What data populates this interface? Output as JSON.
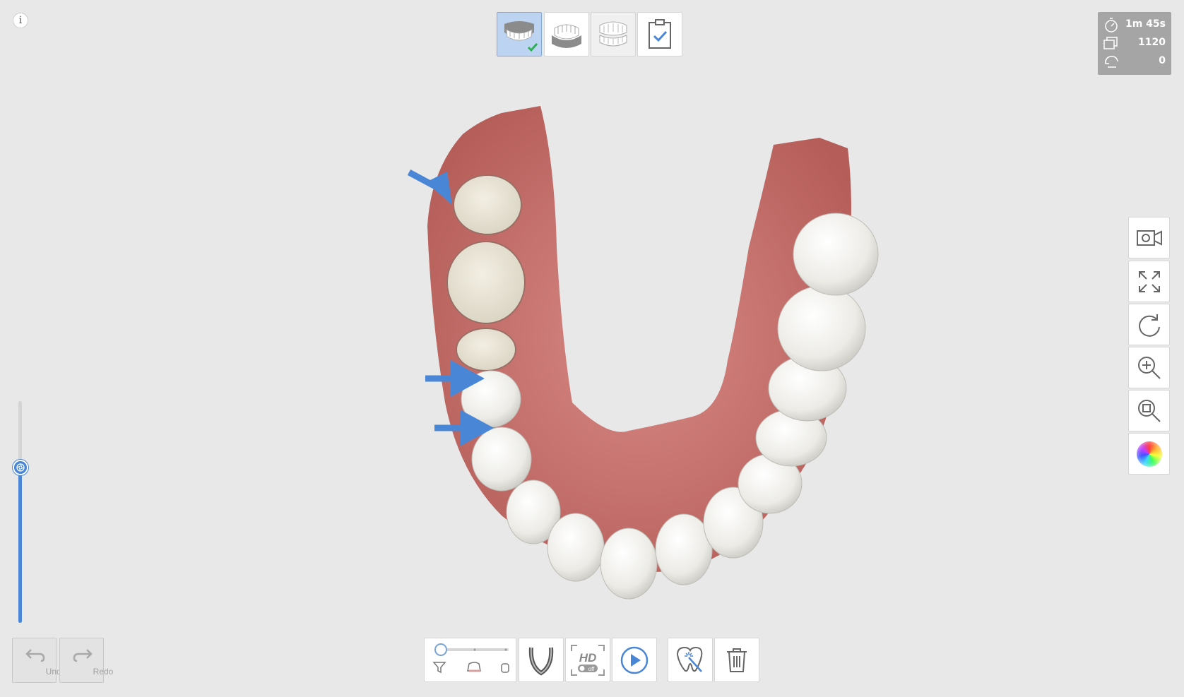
{
  "info_icon": "info-icon",
  "stage_tabs": [
    {
      "name": "maxilla-stage-tab",
      "icon": "upper-jaw-icon",
      "active": true,
      "completed": true
    },
    {
      "name": "mandible-stage-tab",
      "icon": "lower-jaw-icon",
      "active": false
    },
    {
      "name": "occlusion-stage-tab",
      "icon": "occlusion-jaw-icon",
      "active": false
    },
    {
      "name": "review-stage-tab",
      "icon": "clipboard-check-icon",
      "active": false
    }
  ],
  "stats": {
    "time": "1m 45s",
    "frames": "1120",
    "rotations": "0"
  },
  "undo": {
    "label": "Undo"
  },
  "redo": {
    "label": "Redo"
  },
  "filter": {
    "icon": "filter-slider-icon",
    "level": 0
  },
  "toolbar": {
    "arch_icon": "arch-tray-icon",
    "hd_label": "HD",
    "hd_state": "off",
    "play_icon": "play-icon",
    "ai_clean_icon": "tooth-wand-icon",
    "delete_icon": "trash-icon"
  },
  "right_tools": [
    "video-camera-icon",
    "fit-screen-icon",
    "refresh-icon",
    "zoom-in-icon",
    "zoom-fit-icon",
    "color-wheel-icon"
  ],
  "scan_depth_level": 0.7,
  "colors": {
    "accent": "#4a86d6",
    "gum": "#c9706c",
    "tooth": "#f2f0ea",
    "background": "#e8e8e8"
  }
}
